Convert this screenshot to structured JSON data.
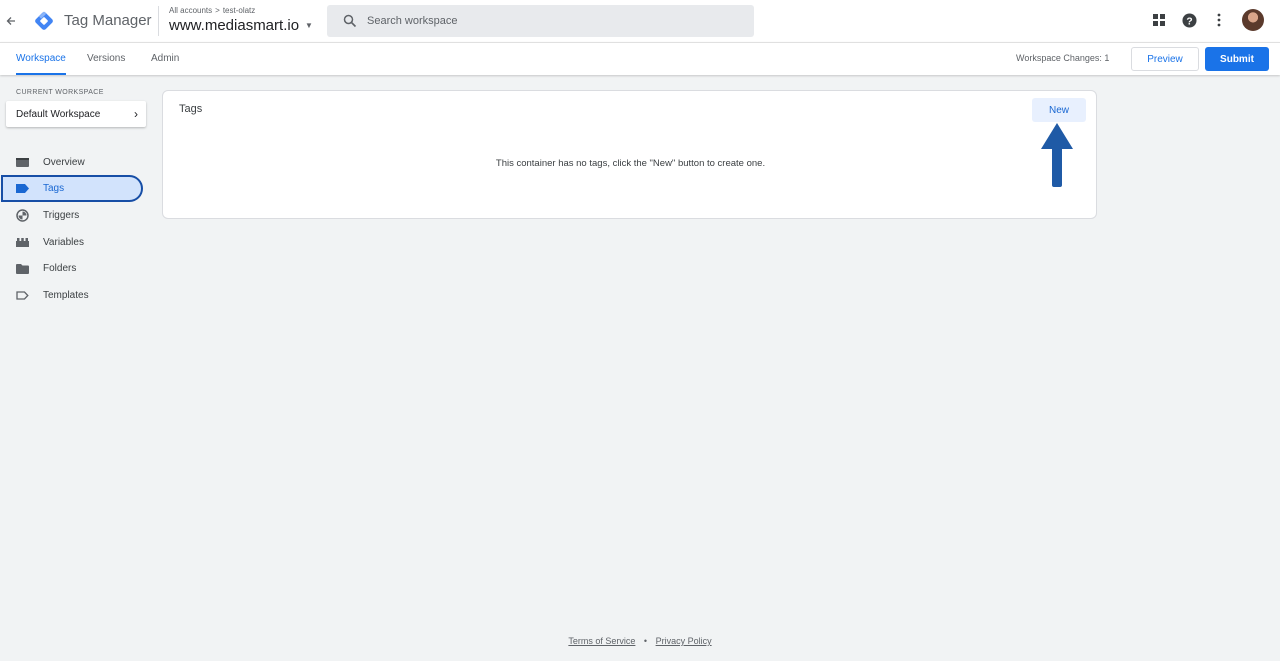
{
  "header": {
    "app_name": "Tag Manager",
    "breadcrumb": {
      "accounts": "All accounts",
      "separator": ">",
      "account": "test-olatz"
    },
    "container_name": "www.mediasmart.io",
    "search_placeholder": "Search workspace",
    "icons": [
      "arrow-back-icon",
      "gtm-logo-icon",
      "apps-icon",
      "help-icon",
      "more-vert-icon",
      "avatar"
    ]
  },
  "nav": {
    "tabs": [
      {
        "label": "Workspace",
        "active": true
      },
      {
        "label": "Versions",
        "active": false
      },
      {
        "label": "Admin",
        "active": false
      }
    ],
    "workspace_changes": "Workspace Changes: 1",
    "preview_label": "Preview",
    "submit_label": "Submit"
  },
  "sidebar": {
    "current_workspace_label": "CURRENT WORKSPACE",
    "workspace_name": "Default Workspace",
    "items": [
      {
        "label": "Overview",
        "icon": "overview-icon",
        "active": false
      },
      {
        "label": "Tags",
        "icon": "tag-icon",
        "active": true
      },
      {
        "label": "Triggers",
        "icon": "trigger-icon",
        "active": false
      },
      {
        "label": "Variables",
        "icon": "variables-icon",
        "active": false
      },
      {
        "label": "Folders",
        "icon": "folder-icon",
        "active": false
      },
      {
        "label": "Templates",
        "icon": "template-icon",
        "active": false
      }
    ]
  },
  "main": {
    "card_title": "Tags",
    "new_label": "New",
    "empty_message": "This container has no tags, click the \"New\" button to create one."
  },
  "footer": {
    "terms": "Terms of Service",
    "separator": "•",
    "privacy": "Privacy Policy"
  },
  "colors": {
    "accent": "#1a73e8",
    "active_bg": "#d2e3fc",
    "active_border": "#174ea6",
    "annotation_arrow": "#1f5aa6"
  }
}
